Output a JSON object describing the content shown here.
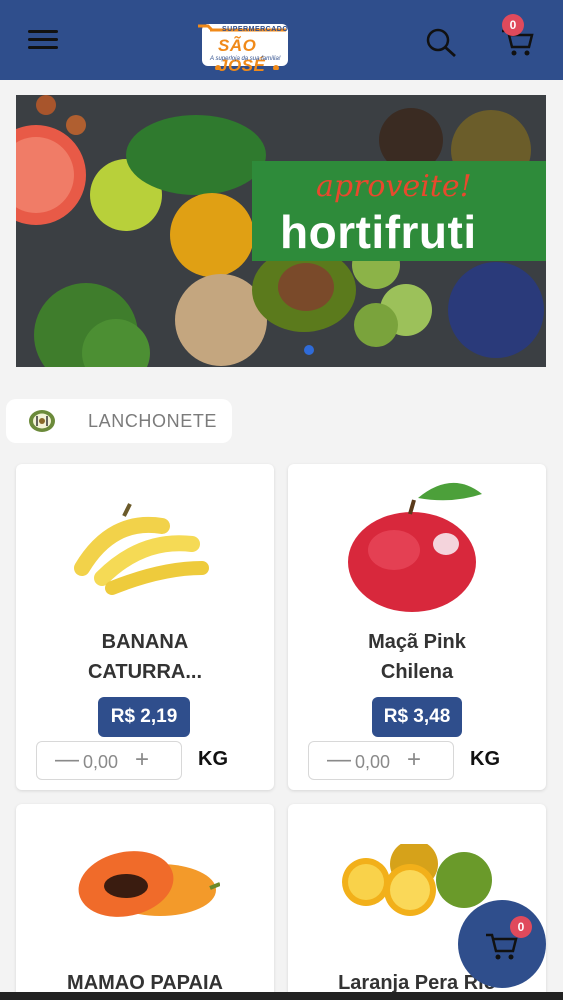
{
  "header": {
    "logo": {
      "top_text": "SUPERMERCADO",
      "name": "SÃO JOSÉ",
      "tagline": "A superloja da sua família!"
    },
    "cart_count": "0"
  },
  "banner": {
    "script_text": "aproveite!",
    "title": "hortifruti"
  },
  "category_chip": {
    "label": "LANCHONETE"
  },
  "products": [
    {
      "name_line1": "BANANA",
      "name_line2": "CATURRA...",
      "price": "R$ 2,19",
      "qty": "0,00",
      "unit": "KG"
    },
    {
      "name_line1": "Maçã Pink",
      "name_line2": "Chilena",
      "price": "R$ 3,48",
      "qty": "0,00",
      "unit": "KG"
    },
    {
      "name_line1": "MAMAO PAPAIA",
      "name_line2": ""
    },
    {
      "name_line1": "Laranja Pera Rio",
      "name_line2": ""
    }
  ],
  "qty_controls": {
    "minus": "—",
    "plus": "+"
  },
  "floating_cart": {
    "count": "0"
  },
  "colors": {
    "primary": "#2f4e8c",
    "badge": "#e04a5c",
    "banner_green": "#2e8b3a"
  },
  "icons": [
    "menu-icon",
    "search-icon",
    "cart-icon",
    "category-icon"
  ]
}
